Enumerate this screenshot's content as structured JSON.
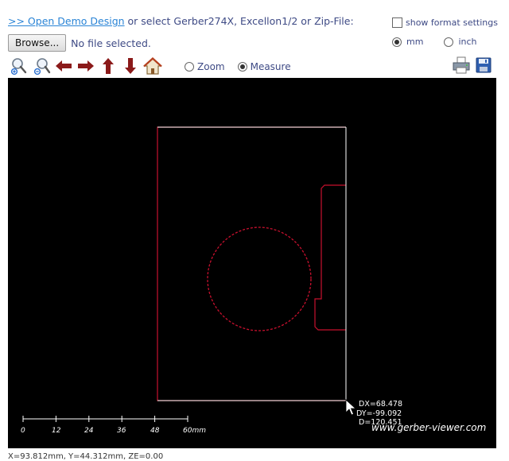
{
  "header": {
    "demo_link": ">> Open Demo Design",
    "select_text": " or select Gerber274X, Excellon1/2 or Zip-File:",
    "show_format_settings": "show format settings"
  },
  "file": {
    "browse_label": "Browse...",
    "status": "No file selected."
  },
  "units": {
    "options": [
      "mm",
      "inch"
    ],
    "selected": "mm"
  },
  "toolbar": {
    "tools": [
      "zoom-in-icon",
      "zoom-out-icon",
      "arrow-left-icon",
      "arrow-right-icon",
      "arrow-up-icon",
      "arrow-down-icon",
      "home-icon"
    ],
    "modes": [
      "Zoom",
      "Measure"
    ],
    "selected_mode": "Measure",
    "right_tools": [
      "print-icon",
      "save-icon"
    ]
  },
  "colors": {
    "canvas_bg": "#000000",
    "outline": "#c8102e",
    "measure_line": "#ffffff",
    "link": "#2a84d6",
    "arrow": "#8b1a1a"
  },
  "measurement": {
    "dx": "DX=68.478",
    "dy": "DY=-99.092",
    "d": "D=120.451"
  },
  "scale": {
    "labels": [
      "0",
      "12",
      "24",
      "36",
      "48",
      "60mm"
    ]
  },
  "watermark": "www.gerber-viewer.com",
  "statusbar": "X=93.812mm, Y=44.312mm, ZE=0.00"
}
